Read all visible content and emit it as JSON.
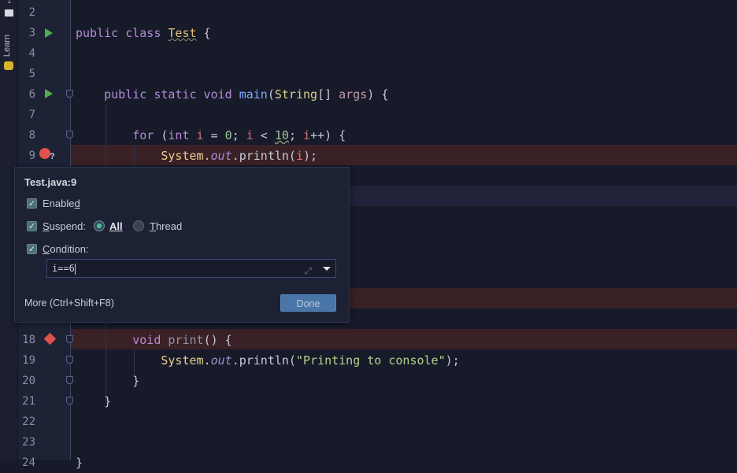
{
  "sidebar": {
    "top_number": "1",
    "learn_label": "Learn"
  },
  "editor": {
    "line_numbers": [
      "2",
      "3",
      "4",
      "5",
      "6",
      "7",
      "8",
      "9",
      "18",
      "19",
      "20",
      "21",
      "22",
      "23",
      "24"
    ],
    "lines": [
      {
        "n": 3,
        "tokens": [
          [
            "kw",
            "public class "
          ],
          [
            "cls",
            "Test"
          ],
          [
            "pl",
            " {"
          ]
        ]
      },
      {
        "n": 6,
        "tokens": [
          [
            "pl",
            "    "
          ],
          [
            "kw",
            "public static void "
          ],
          [
            "fn",
            "main"
          ],
          [
            "pl",
            "("
          ],
          [
            "type",
            "String"
          ],
          [
            "pl",
            "[] "
          ],
          [
            "param",
            "args"
          ],
          [
            "pl",
            ") {"
          ]
        ]
      },
      {
        "n": 8,
        "tokens": [
          [
            "pl",
            "        "
          ],
          [
            "kw",
            "for "
          ],
          [
            "pl",
            "("
          ],
          [
            "kw",
            "int "
          ],
          [
            "var",
            "i"
          ],
          [
            "pl",
            " = "
          ],
          [
            "num",
            "0"
          ],
          [
            "pl",
            "; "
          ],
          [
            "var",
            "i"
          ],
          [
            "pl",
            " < "
          ],
          [
            "num u",
            "10"
          ],
          [
            "pl",
            "; "
          ],
          [
            "var",
            "i"
          ],
          [
            "pl",
            "++) {"
          ]
        ]
      },
      {
        "n": 9,
        "tokens": [
          [
            "pl",
            "            "
          ],
          [
            "sys",
            "System"
          ],
          [
            "pl",
            "."
          ],
          [
            "out",
            "out"
          ],
          [
            "pl",
            ".println("
          ],
          [
            "var",
            "i"
          ],
          [
            "pl",
            ");"
          ]
        ]
      },
      {
        "n": 18,
        "tokens": [
          [
            "pl",
            "        "
          ],
          [
            "kw",
            "void "
          ],
          [
            "unused",
            "print"
          ],
          [
            "pl",
            "() {"
          ]
        ]
      },
      {
        "n": 19,
        "tokens": [
          [
            "pl",
            "            "
          ],
          [
            "sys",
            "System"
          ],
          [
            "pl",
            "."
          ],
          [
            "out",
            "out"
          ],
          [
            "pl",
            ".println("
          ],
          [
            "str",
            "\"Printing to console\""
          ],
          [
            "pl",
            ");"
          ]
        ]
      },
      {
        "n": 20,
        "tokens": [
          [
            "pl",
            "        }"
          ]
        ]
      },
      {
        "n": 21,
        "tokens": [
          [
            "pl",
            "    }"
          ]
        ]
      },
      {
        "n": 24,
        "tokens": [
          [
            "pl",
            "}"
          ]
        ]
      }
    ]
  },
  "popup": {
    "title": "Test.java:9",
    "enabled_label": "Enable",
    "enabled_mnemonic": "d",
    "enabled": true,
    "suspend_mnemonic": "S",
    "suspend_label": "uspend:",
    "suspend": true,
    "radio_all": "All",
    "radio_thread_mnemonic": "T",
    "radio_thread": "hread",
    "suspend_selected": "All",
    "condition_mnemonic": "C",
    "condition_label": "ondition:",
    "condition": true,
    "condition_value": "i==6",
    "more_link": "More (Ctrl+Shift+F8)",
    "done_label": "Done"
  },
  "colors": {
    "breakpoint": "#e0504c",
    "run": "#4fae4f",
    "done": "#4a75a8"
  }
}
